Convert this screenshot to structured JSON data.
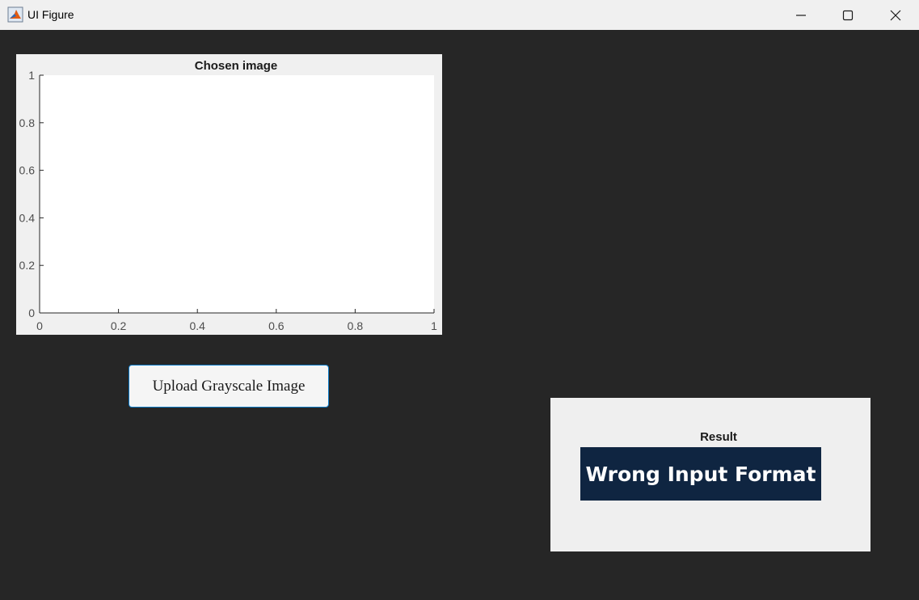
{
  "window": {
    "title": "UI Figure",
    "icon": "matlab-icon"
  },
  "axes": {
    "title": "Chosen image",
    "x_ticks": [
      "0",
      "0.2",
      "0.4",
      "0.6",
      "0.8",
      "1"
    ],
    "y_ticks": [
      "0",
      "0.2",
      "0.4",
      "0.6",
      "0.8",
      "1"
    ],
    "xlim": [
      0,
      1
    ],
    "ylim": [
      0,
      1
    ]
  },
  "upload_button": {
    "label": "Upload Grayscale Image"
  },
  "result": {
    "label": "Result",
    "value": "Wrong Input Format"
  },
  "colors": {
    "background": "#262626",
    "result_box": "#0f2541",
    "button_border": "#0c7ac6"
  }
}
